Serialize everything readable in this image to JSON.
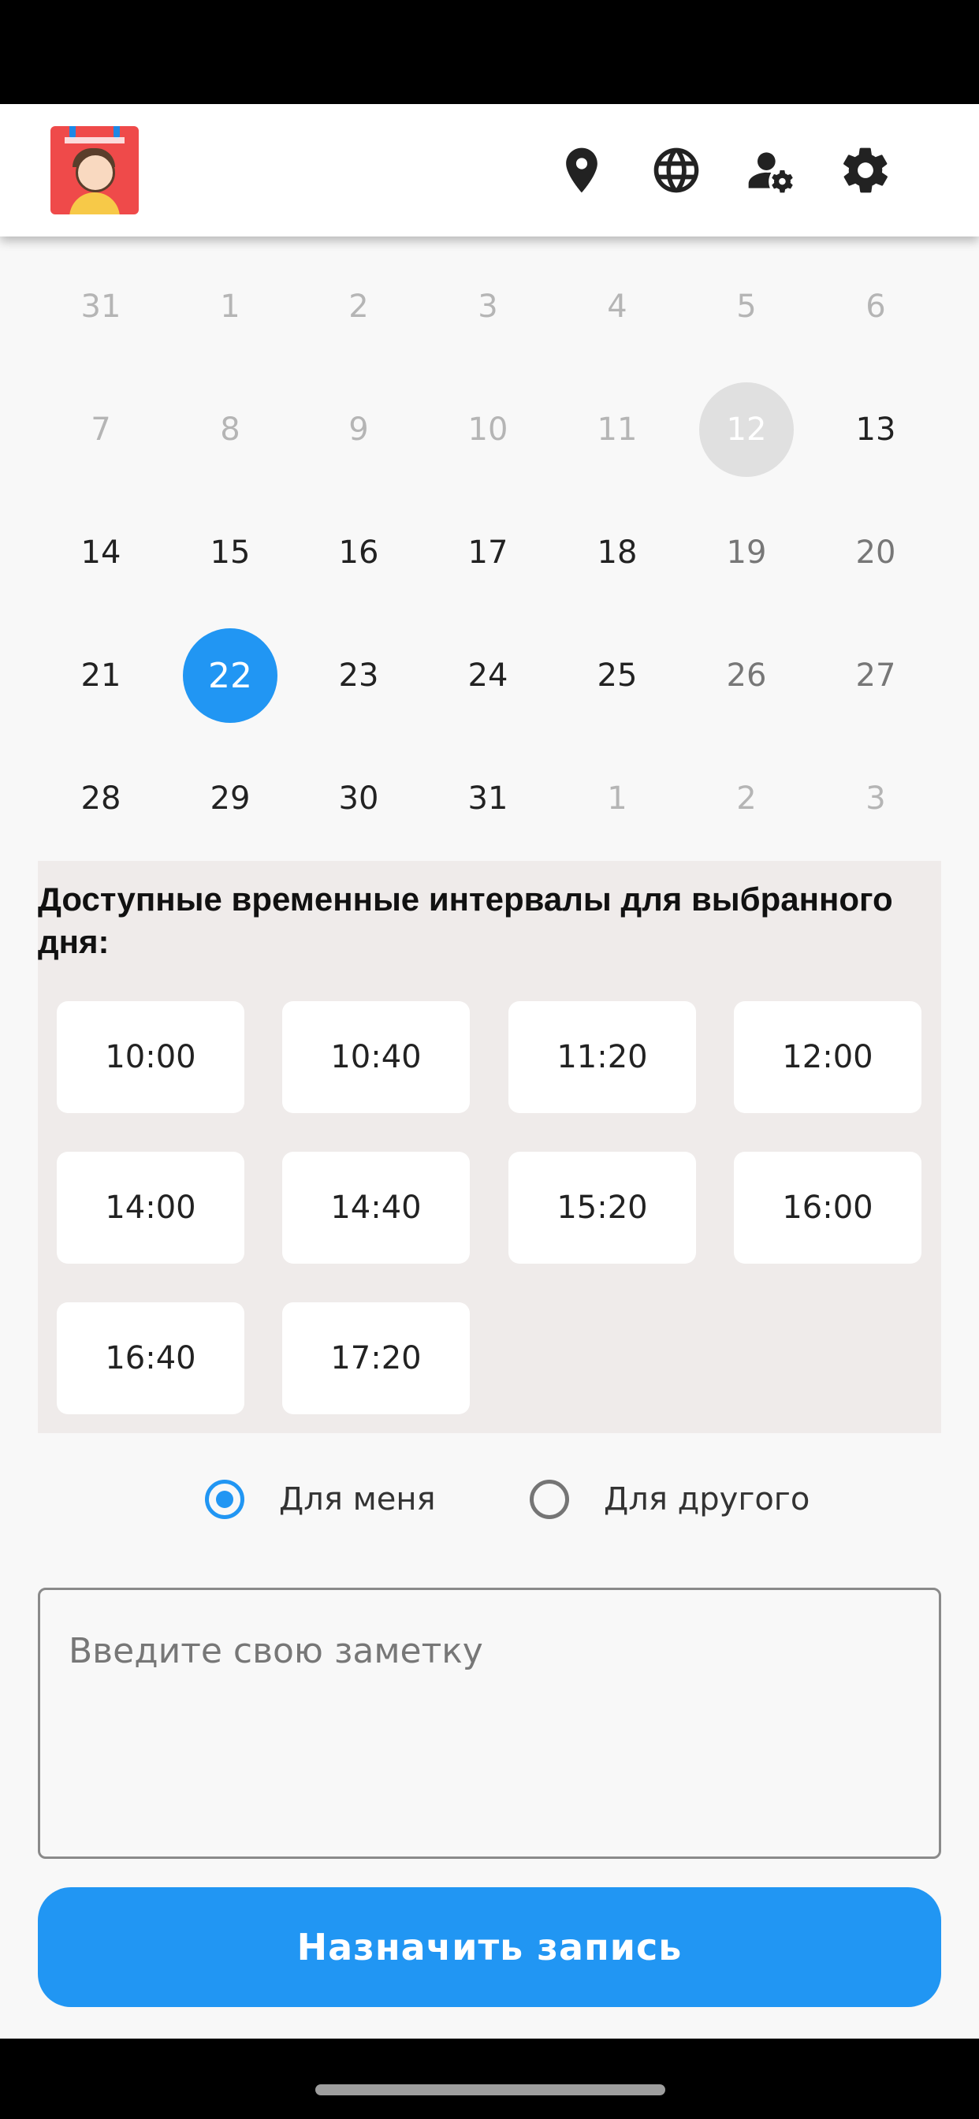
{
  "header": {
    "logo": "calendar-app-logo",
    "icons": [
      "location-pin-icon",
      "globe-icon",
      "user-settings-icon",
      "gear-icon"
    ]
  },
  "calendar": {
    "weeks": [
      [
        "31",
        "1",
        "2",
        "3",
        "4",
        "5",
        "6"
      ],
      [
        "7",
        "8",
        "9",
        "10",
        "11",
        "12",
        "13"
      ],
      [
        "14",
        "15",
        "16",
        "17",
        "18",
        "19",
        "20"
      ],
      [
        "21",
        "22",
        "23",
        "24",
        "25",
        "26",
        "27"
      ],
      [
        "28",
        "29",
        "30",
        "31",
        "1",
        "2",
        "3"
      ]
    ],
    "today": "12",
    "selected": "22"
  },
  "slots": {
    "title": "Доступные временные интервалы для выбранного дня:",
    "times": [
      "10:00",
      "10:40",
      "11:20",
      "12:00",
      "14:00",
      "14:40",
      "15:20",
      "16:00",
      "16:40",
      "17:20"
    ]
  },
  "booking_for": {
    "options": [
      "Для меня",
      "Для другого"
    ],
    "selected_index": 0
  },
  "note": {
    "placeholder": "Введите свою заметку",
    "value": ""
  },
  "submit": {
    "label": "Назначить запись"
  },
  "colors": {
    "accent": "#2196f3",
    "slots_bg": "#efebea",
    "today_bg": "#e0e0e0"
  }
}
